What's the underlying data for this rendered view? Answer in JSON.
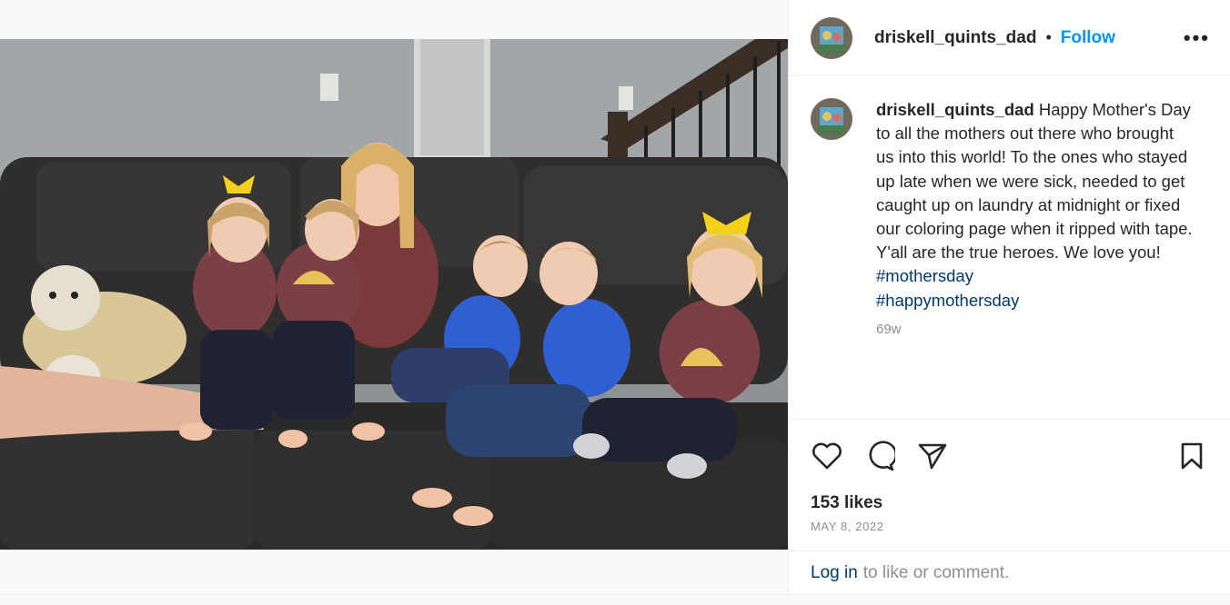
{
  "post": {
    "username": "driskell_quints_dad",
    "separator": "•",
    "follow_label": "Follow",
    "more_label": "•••",
    "caption": {
      "username": "driskell_quints_dad",
      "text": " Happy Mother's Day to all the mothers out there who brought us into this world! To the ones who stayed up late when we were sick, needed to get caught up on laundry at midnight or fixed our coloring page when it ripped with tape. Y'all are the true heroes. We love you! ",
      "hashtags": [
        "#mothersday",
        "#happymothersday"
      ],
      "age": "69w"
    },
    "likes": "153 likes",
    "date": "MAY 8, 2022",
    "comment_bar": {
      "login_label": "Log in",
      "rest": "to like or comment."
    }
  },
  "icons": {
    "like": "heart-icon",
    "comment": "comment-icon",
    "share": "paper-plane-icon",
    "save": "bookmark-icon"
  },
  "colors": {
    "follow": "#0095f6",
    "hashtag": "#00376b",
    "muted": "#8e8e8e"
  }
}
